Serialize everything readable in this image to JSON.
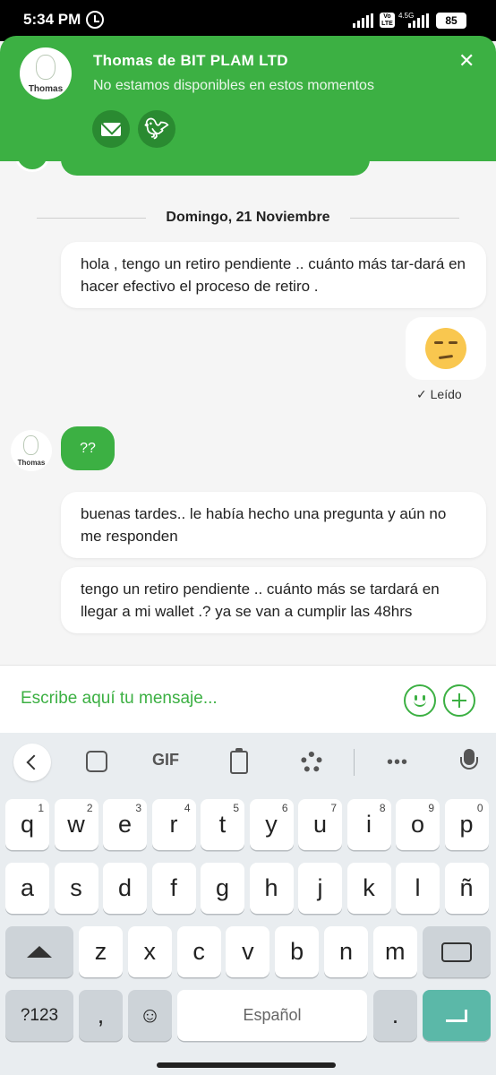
{
  "status_bar": {
    "time": "5:34 PM",
    "volte": "Vo LTE",
    "network": "4.5G",
    "battery": "85"
  },
  "header": {
    "avatar_label": "Thomas",
    "title": "Thomas de BIT PLAM LTD",
    "subtitle": "No estamos disponibles en estos momentos",
    "close_glyph": "✕",
    "email_icon": "mail-icon",
    "twitter_icon": "twitter-icon"
  },
  "chat": {
    "date_separator": "Domingo, 21 Noviembre",
    "messages": [
      {
        "text": "hola , tengo un retiro pendiente .. cuánto más tar-dará en hacer efectivo el proceso de retiro ."
      },
      {
        "emoji": "unamused-face"
      },
      {
        "status": "Leído"
      },
      {
        "agent_avatar_label": "Thomas",
        "text": "??"
      },
      {
        "text": "buenas tardes.. le había hecho una pregunta y aún no me responden"
      },
      {
        "text": "tengo un retiro pendiente .. cuánto más se tardará en llegar a mi wallet .? ya se van a cumplir las 48hrs"
      }
    ]
  },
  "composer": {
    "placeholder": "Escribe aquí tu mensaje..."
  },
  "keyboard": {
    "toolbar": {
      "gif_label": "GIF",
      "more_label": "•••"
    },
    "row1": [
      [
        "q",
        "1"
      ],
      [
        "w",
        "2"
      ],
      [
        "e",
        "3"
      ],
      [
        "r",
        "4"
      ],
      [
        "t",
        "5"
      ],
      [
        "y",
        "6"
      ],
      [
        "u",
        "7"
      ],
      [
        "i",
        "8"
      ],
      [
        "o",
        "9"
      ],
      [
        "p",
        "0"
      ]
    ],
    "row2": [
      "a",
      "s",
      "d",
      "f",
      "g",
      "h",
      "j",
      "k",
      "l",
      "ñ"
    ],
    "row3": [
      "z",
      "x",
      "c",
      "v",
      "b",
      "n",
      "m"
    ],
    "bottom": {
      "symbols": "?123",
      "comma": ",",
      "space": "Español",
      "period": "."
    }
  },
  "colors": {
    "accent": "#3cb043",
    "enter_key": "#5bb8a8"
  }
}
